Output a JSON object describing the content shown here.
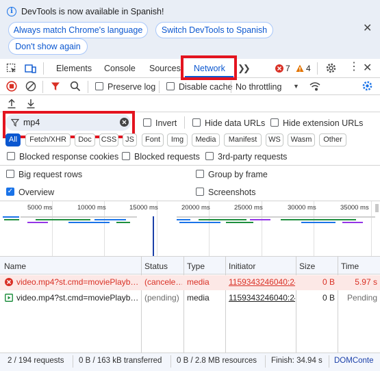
{
  "infobar": {
    "message": "DevTools is now available in Spanish!",
    "buttons": [
      "Always match Chrome's language",
      "Switch DevTools to Spanish",
      "Don't show again"
    ]
  },
  "tabs": [
    "Elements",
    "Console",
    "Sources",
    "Network"
  ],
  "badges": {
    "errors": "7",
    "warnings": "4"
  },
  "toolbar": {
    "preserve_log": "Preserve log",
    "disable_cache": "Disable cache",
    "throttling": "No throttling"
  },
  "filter": {
    "value": "mp4",
    "invert": "Invert",
    "hide_data_urls": "Hide data URLs",
    "hide_extension_urls": "Hide extension URLs"
  },
  "type_filters": [
    "All",
    "Fetch/XHR",
    "Doc",
    "CSS",
    "JS",
    "Font",
    "Img",
    "Media",
    "Manifest",
    "WS",
    "Wasm",
    "Other"
  ],
  "more_filters": {
    "blocked_cookies": "Blocked response cookies",
    "blocked_requests": "Blocked requests",
    "third_party": "3rd-party requests"
  },
  "options": {
    "big_rows": "Big request rows",
    "group_by_frame": "Group by frame",
    "overview": "Overview",
    "screenshots": "Screenshots"
  },
  "timeline_ticks": [
    "5000 ms",
    "10000 ms",
    "15000 ms",
    "20000 ms",
    "25000 ms",
    "30000 ms",
    "35000 ms"
  ],
  "table": {
    "headers": [
      "Name",
      "Status",
      "Type",
      "Initiator",
      "Size",
      "Time"
    ],
    "rows": [
      {
        "name": "video.mp4?st.cmd=moviePlayb…",
        "status": "(cancele…",
        "type": "media",
        "initiator": "1159343246040:24",
        "size": "0 B",
        "time": "5.97 s",
        "error": true
      },
      {
        "name": "video.mp4?st.cmd=moviePlayb…",
        "status": "(pending)",
        "type": "media",
        "initiator": "1159343246040:24",
        "size": "0 B",
        "time": "Pending",
        "error": false
      }
    ]
  },
  "statusbar": {
    "requests": "2 / 194 requests",
    "transferred": "0 B / 163 kB transferred",
    "resources": "0 B / 2.8 MB resources",
    "finish": "Finish: 34.94 s",
    "domcontent": "DOMConte"
  },
  "colors": {
    "accent": "#0b57d0",
    "error": "#d93025",
    "warning": "#e37400",
    "highlight": "#e3141f"
  }
}
